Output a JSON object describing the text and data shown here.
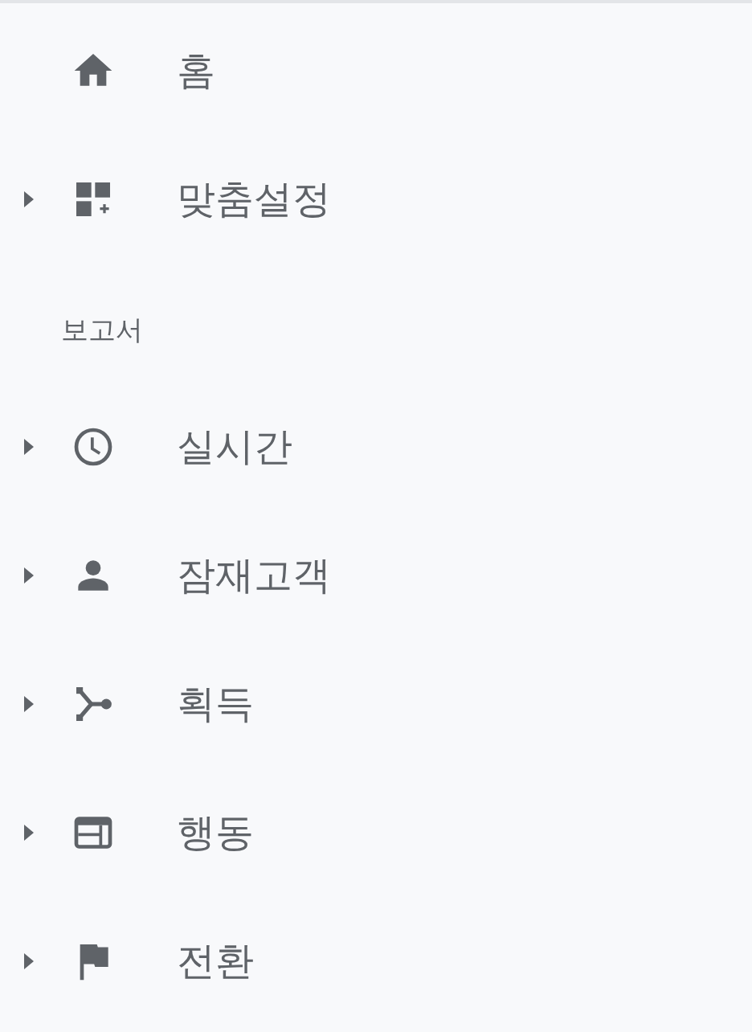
{
  "nav": [
    {
      "label": "홈",
      "expandable": false
    },
    {
      "label": "맞춤설정",
      "expandable": true
    }
  ],
  "reports": {
    "heading": "보고서",
    "items": [
      {
        "label": "실시간",
        "expandable": true
      },
      {
        "label": "잠재고객",
        "expandable": true
      },
      {
        "label": "획득",
        "expandable": true
      },
      {
        "label": "행동",
        "expandable": true
      },
      {
        "label": "전환",
        "expandable": true
      }
    ]
  }
}
